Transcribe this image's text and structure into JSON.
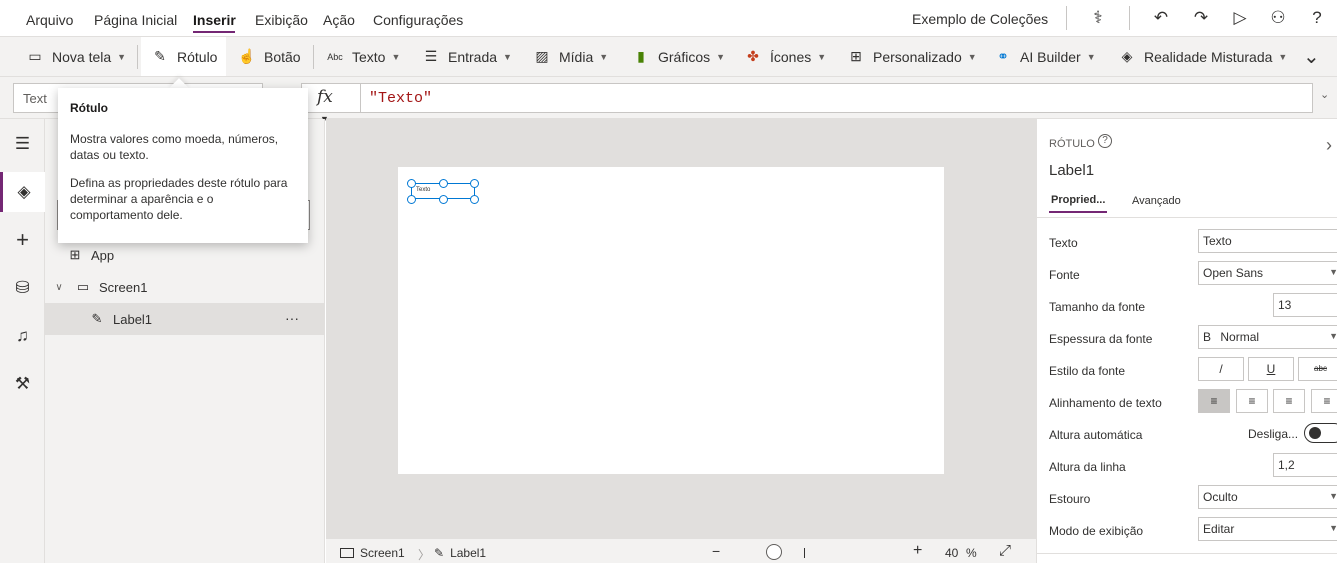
{
  "menu": {
    "items": [
      "Arquivo",
      "Página Inicial",
      "Inserir",
      "Exibição",
      "Ação",
      "Configurações"
    ]
  },
  "app_name": "Exemplo de Coleções",
  "top_icons": {
    "stethoscope": "⚕",
    "undo": "↶",
    "redo": "↷",
    "play": "▷",
    "person": "⚇",
    "help": "?"
  },
  "ribbon": {
    "nova_tela": "Nova tela",
    "rotulo": "Rótulo",
    "botao": "Botão",
    "texto": "Texto",
    "entrada": "Entrada",
    "midia": "Mídia",
    "graficos": "Gráficos",
    "icones": "Ícones",
    "personalizado": "Personalizado",
    "ai_builder": "AI Builder",
    "realidade": "Realidade Misturada",
    "more": "⌄"
  },
  "formula": {
    "property": "Text",
    "fx": "fx",
    "value": "\"Texto\""
  },
  "tooltip": {
    "title": "Rótulo",
    "p1": "Mostra valores como moeda, números, datas ou texto.",
    "p2": "Defina as propriedades deste rótulo para determinar a aparência e o comportamento dele."
  },
  "tree": {
    "app": "App",
    "screen": "Screen1",
    "label": "Label1",
    "more": "···"
  },
  "canvas": {
    "label_text": "Texto"
  },
  "statusbar": {
    "screen": "Screen1",
    "label": "Label1",
    "zoom_minus": "−",
    "zoom_plus": "+",
    "zoom": "40",
    "zoom_unit": "%"
  },
  "props": {
    "type": "RÓTULO",
    "help": "?",
    "name": "Label1",
    "tab_props": "Propried...",
    "tab_adv": "Avançado",
    "rows": {
      "texto": {
        "label": "Texto",
        "value": "Texto"
      },
      "fonte": {
        "label": "Fonte",
        "value": "Open Sans"
      },
      "tamanho": {
        "label": "Tamanho da fonte",
        "value": "13"
      },
      "espessura": {
        "label": "Espessura da fonte",
        "value": "Normal",
        "icon": "B"
      },
      "estilo": {
        "label": "Estilo da fonte",
        "italic": "/",
        "underline": "U",
        "strike": "abc"
      },
      "alinhamento": {
        "label": "Alinhamento de texto"
      },
      "altura_auto": {
        "label": "Altura automática",
        "value": "Desliga..."
      },
      "altura_linha": {
        "label": "Altura da linha",
        "value": "1,2"
      },
      "estouro": {
        "label": "Estouro",
        "value": "Oculto"
      },
      "modo": {
        "label": "Modo de exibição",
        "value": "Editar"
      }
    }
  }
}
